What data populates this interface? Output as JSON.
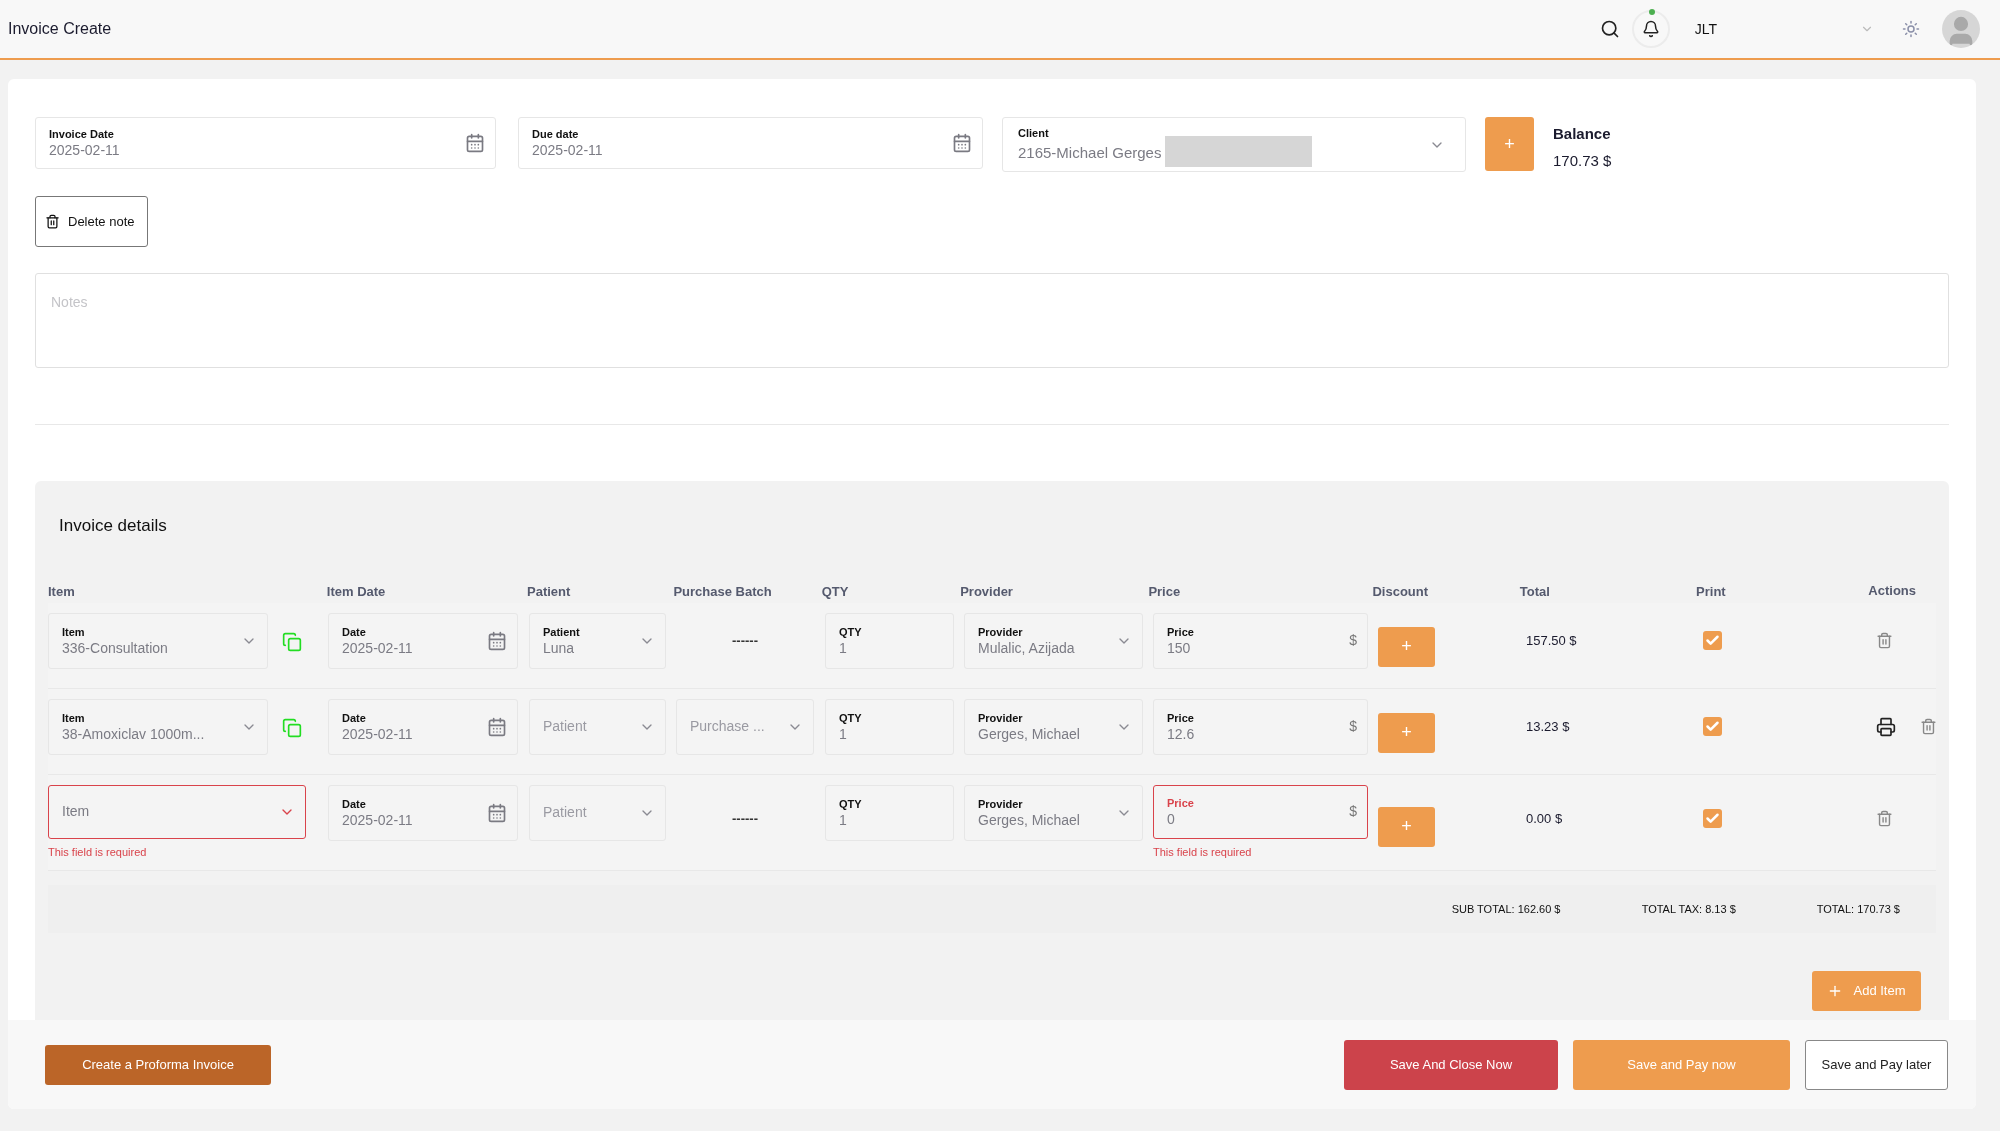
{
  "header": {
    "title": "Invoice Create",
    "user": "JLT",
    "has_unread": true
  },
  "invoice_date": {
    "label": "Invoice Date",
    "value": "2025-02-11"
  },
  "due_date": {
    "label": "Due date",
    "value": "2025-02-11"
  },
  "client": {
    "label": "Client",
    "value": "2165-Michael Gerges"
  },
  "add_client_button": "+",
  "balance": {
    "label": "Balance",
    "value": "170.73 $"
  },
  "delete_note_button": "Delete note",
  "notes": {
    "placeholder": "Notes"
  },
  "invoice_details": {
    "title": "Invoice details",
    "columns": [
      "Item",
      "Item Date",
      "Patient",
      "Purchase Batch",
      "QTY",
      "Provider",
      "Price",
      "Discount",
      "Total",
      "Print",
      "Actions"
    ],
    "rows": [
      {
        "item": {
          "label": "Item",
          "value": "336-Consultation",
          "invalid": false
        },
        "copyable": true,
        "date": {
          "label": "Date",
          "value": "2025-02-11"
        },
        "patient": {
          "label": "Patient",
          "value": "Luna"
        },
        "batch": {
          "kind": "text",
          "value": "------"
        },
        "qty": {
          "label": "QTY",
          "value": "1"
        },
        "provider": {
          "label": "Provider",
          "value": "Mulalic, Azijada"
        },
        "price": {
          "label": "Price",
          "value": "150",
          "currency": "$",
          "invalid": false
        },
        "discount_button": "+",
        "total": "157.50 $",
        "print_checked": true,
        "printable": false
      },
      {
        "item": {
          "label": "Item",
          "value": "38-Amoxiclav 1000m...",
          "invalid": false
        },
        "copyable": true,
        "date": {
          "label": "Date",
          "value": "2025-02-11"
        },
        "patient": {
          "placeholder": "Patient"
        },
        "batch": {
          "kind": "select",
          "placeholder": "Purchase ..."
        },
        "qty": {
          "label": "QTY",
          "value": "1"
        },
        "provider": {
          "label": "Provider",
          "value": "Gerges, Michael"
        },
        "price": {
          "label": "Price",
          "value": "12.6",
          "currency": "$",
          "invalid": false
        },
        "discount_button": "+",
        "total": "13.23 $",
        "print_checked": true,
        "printable": true
      },
      {
        "item": {
          "placeholder": "Item",
          "invalid": true,
          "error": "This field is required"
        },
        "copyable": false,
        "date": {
          "label": "Date",
          "value": "2025-02-11"
        },
        "patient": {
          "placeholder": "Patient"
        },
        "batch": {
          "kind": "text",
          "value": "------"
        },
        "qty": {
          "label": "QTY",
          "value": "1"
        },
        "provider": {
          "label": "Provider",
          "value": "Gerges, Michael"
        },
        "price": {
          "label": "Price",
          "value": "0",
          "currency": "$",
          "invalid": true,
          "error": "This field is required"
        },
        "discount_button": "+",
        "total": "0.00 $",
        "print_checked": true,
        "printable": false
      }
    ],
    "totals": [
      "SUB TOTAL: 162.60 $",
      "TOTAL TAX: 8.13 $",
      "TOTAL: 170.73 $"
    ],
    "add_item_button": "Add Item"
  },
  "footer_buttons": [
    {
      "label": "Create a Proforma Invoice",
      "kind": "proforma"
    },
    {
      "label": "Save And Close Now",
      "kind": "danger"
    },
    {
      "label": "Save and Pay now",
      "kind": "primary"
    },
    {
      "label": "Save and Pay later",
      "kind": "outline"
    }
  ]
}
